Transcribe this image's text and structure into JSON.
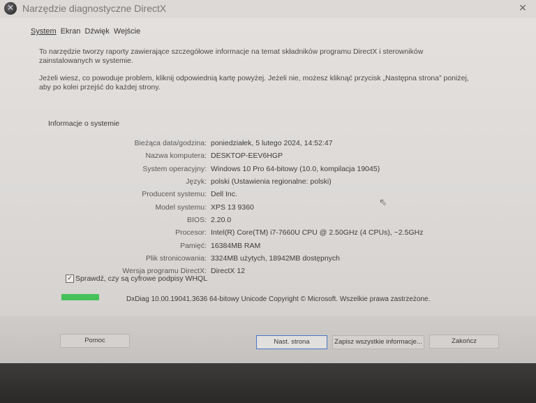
{
  "window": {
    "title": "Narzędzie diagnostyczne DirectX",
    "close_glyph": "✕"
  },
  "tabs": [
    {
      "label": "System",
      "active": true
    },
    {
      "label": "Ekran"
    },
    {
      "label": "Dźwięk"
    },
    {
      "label": "Wejście"
    }
  ],
  "intro": {
    "paragraph1": "To narzędzie tworzy raporty zawierające szczegółowe informacje na temat składników programu DirectX i sterowników zainstalowanych w systemie.",
    "paragraph2": "Jeżeli wiesz, co powoduje problem, kliknij odpowiednią kartę powyżej. Jeżeli nie, możesz kliknąć przycisk „Następna strona” poniżej, aby po kolei przejść do każdej strony."
  },
  "system_info": {
    "title": "Informacje o systemie",
    "rows": [
      {
        "label": "Bieżąca data/godzina:",
        "value": "poniedziałek, 5 lutego 2024, 14:52:47"
      },
      {
        "label": "Nazwa komputera:",
        "value": "DESKTOP-EEV6HGP"
      },
      {
        "label": "System operacyjny:",
        "value": "Windows 10 Pro 64-bitowy (10.0, kompilacja 19045)"
      },
      {
        "label": "Język:",
        "value": "polski (Ustawienia regionalne: polski)"
      },
      {
        "label": "Producent systemu:",
        "value": "Dell Inc."
      },
      {
        "label": "Model systemu:",
        "value": "XPS 13 9360"
      },
      {
        "label": "BIOS:",
        "value": "2.20.0"
      },
      {
        "label": "Procesor:",
        "value": "Intel(R) Core(TM) i7-7660U CPU @ 2.50GHz (4 CPUs), ~2.5GHz"
      },
      {
        "label": "Pamięć:",
        "value": "16384MB RAM"
      },
      {
        "label": "Plik stronicowania:",
        "value": "3324MB użytych, 18942MB dostępnych"
      },
      {
        "label": "Wersja programu DirectX:",
        "value": "DirectX 12"
      }
    ]
  },
  "whql_check": {
    "label": "Sprawdź, czy są cyfrowe podpisy WHQL",
    "checked": true,
    "glyph": "✓"
  },
  "status": {
    "progress": 1.0,
    "text": "DxDiag 10.00.19041.3636 64-bitowy Unicode  Copyright © Microsoft. Wszelkie prawa zastrzeżone."
  },
  "buttons": {
    "help": "Pomoc",
    "next": "Nast. strona",
    "save_all": "Zapisz wszystkie informacje...",
    "exit": "Zakończ"
  }
}
